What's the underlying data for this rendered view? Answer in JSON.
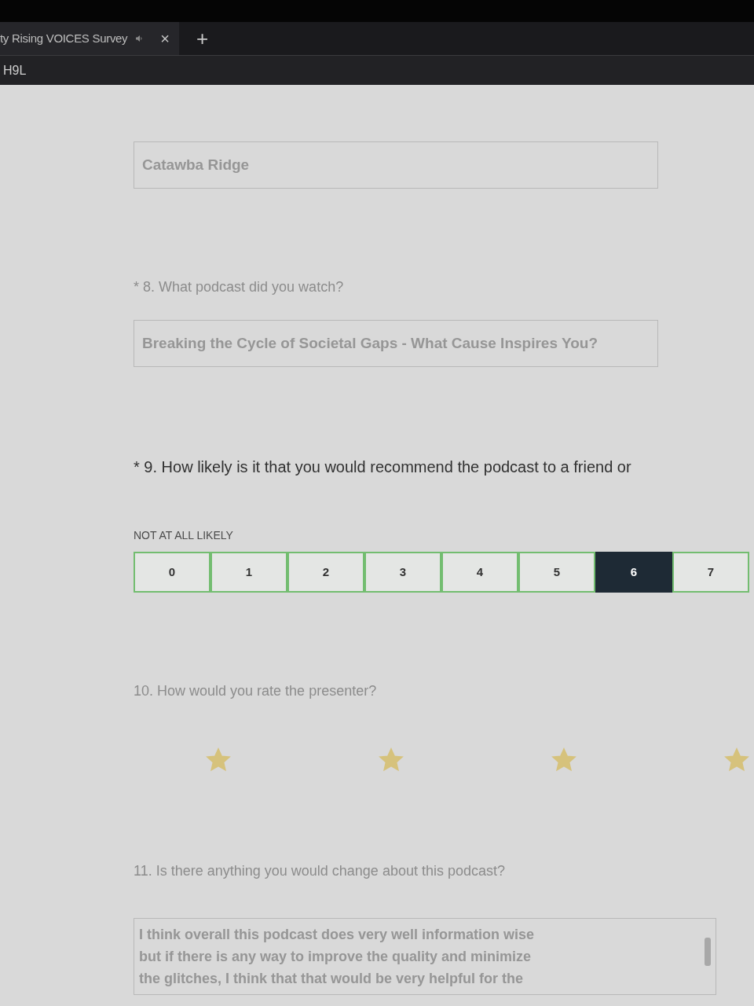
{
  "browser": {
    "tab_title": "ty Rising VOICES Survey",
    "tab_close": "×",
    "new_tab": "+",
    "address": "H9L"
  },
  "questions": [
    {
      "kind": "text",
      "focused": false,
      "value": "Catawba Ridge"
    },
    {
      "kind": "text",
      "focused": false,
      "label": "* 8. What podcast did you watch?",
      "value": "Breaking the Cycle of Societal Gaps - What Cause Inspires You?"
    },
    {
      "kind": "scale",
      "focused": true,
      "label": "* 9. How likely is it that you would recommend the podcast to a friend or",
      "scale_label": "NOT AT ALL LIKELY",
      "options": [
        {
          "label": "0",
          "selected": false
        },
        {
          "label": "1",
          "selected": false
        },
        {
          "label": "2",
          "selected": false
        },
        {
          "label": "3",
          "selected": false
        },
        {
          "label": "4",
          "selected": false
        },
        {
          "label": "5",
          "selected": false
        },
        {
          "label": "6",
          "selected": true
        },
        {
          "label": "7",
          "selected": false
        }
      ]
    },
    {
      "kind": "stars",
      "focused": false,
      "label": "10. How would you rate the presenter?",
      "stars": 4
    },
    {
      "kind": "textarea",
      "focused": false,
      "label": "11. Is there anything you would change about this podcast?",
      "value_lines": [
        "I think overall this podcast does very well information wise",
        "but if there is any way to improve the quality and minimize",
        "the glitches, I think that that would be very helpful for the"
      ]
    }
  ]
}
